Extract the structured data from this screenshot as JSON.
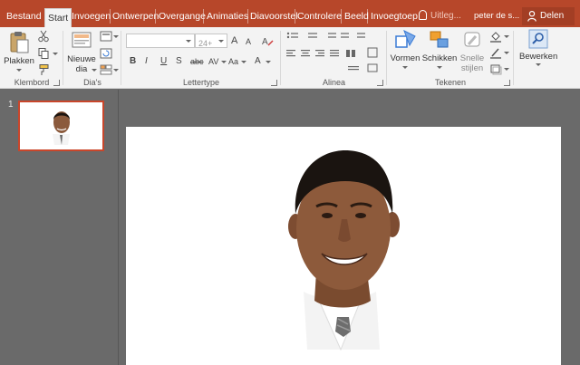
{
  "tabs": [
    {
      "label": "Bestand",
      "active": false
    },
    {
      "label": "Start",
      "active": true
    },
    {
      "label": "Invoegen",
      "active": false
    },
    {
      "label": "Ontwerpen",
      "active": false
    },
    {
      "label": "Overgange",
      "active": false
    },
    {
      "label": "Animaties",
      "active": false
    },
    {
      "label": "Diavoorstel",
      "active": false
    },
    {
      "label": "Controlere",
      "active": false
    },
    {
      "label": "Beeld",
      "active": false
    },
    {
      "label": "Invoegtoep",
      "active": false
    }
  ],
  "tell_me": "Uitleg...",
  "user_name": "peter de s...",
  "share_label": "Delen",
  "ribbon": {
    "clipboard": {
      "paste_label": "Plakken",
      "group_label": "Klembord"
    },
    "slides": {
      "new_slide_label_1": "Nieuwe",
      "new_slide_label_2": "dia",
      "group_label": "Dia's"
    },
    "font": {
      "font_name": "",
      "font_size": "24+",
      "bold": "B",
      "italic": "I",
      "underline": "U",
      "strike": "S",
      "spacing": "AV",
      "case": "Aa",
      "grow": "A",
      "shrink": "A",
      "color": "A",
      "group_label": "Lettertype"
    },
    "paragraph": {
      "group_label": "Alinea"
    },
    "drawing": {
      "shapes_label": "Vormen",
      "arrange_label": "Schikken",
      "quick_styles_label_1": "Snelle",
      "quick_styles_label_2": "stijlen",
      "group_label": "Tekenen"
    },
    "editing": {
      "edit_label": "Bewerken"
    }
  },
  "thumbnail": {
    "slide_number": "1"
  },
  "colors": {
    "accent": "#b7472a",
    "selection": "#c9462b",
    "ribbon_bg": "#f3f3f3",
    "workspace_bg": "#6a6a6a"
  }
}
